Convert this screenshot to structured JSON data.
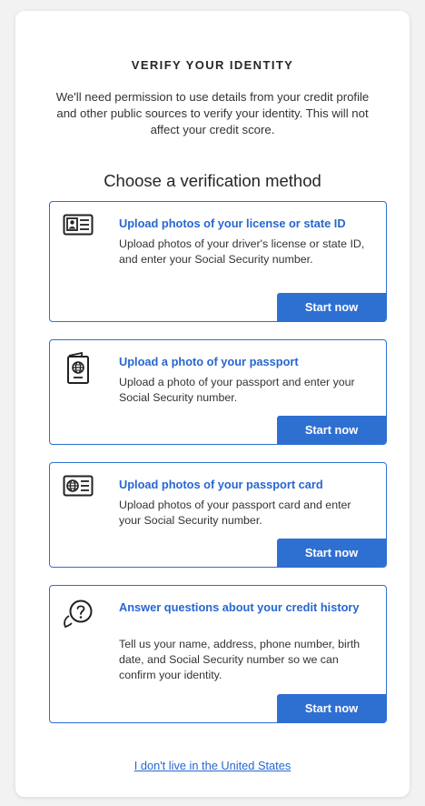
{
  "header": {
    "title": "VERIFY YOUR IDENTITY",
    "intro": "We'll need permission to use details from your credit profile and other public sources to verify your identity. This will not affect your credit score.",
    "choose_heading": "Choose a verification method"
  },
  "methods": [
    {
      "icon": "id-card-icon",
      "title": "Upload photos of your license or state ID",
      "description": "Upload photos of your driver's license or state ID, and enter your Social Security number.",
      "button": "Start now"
    },
    {
      "icon": "passport-icon",
      "title": "Upload a photo of your passport",
      "description": "Upload a photo of your passport and enter your Social Security number.",
      "button": "Start now"
    },
    {
      "icon": "passport-card-icon",
      "title": "Upload photos of your passport card",
      "description": "Upload photos of your passport card and enter your Social Security number.",
      "button": "Start now"
    },
    {
      "icon": "question-bubble-icon",
      "title": "Answer questions about your credit history",
      "description": "Tell us your name, address, phone number, birth date, and Social Security number so we can confirm your identity.",
      "button": "Start now"
    }
  ],
  "footer": {
    "link": "I don't live in the United States"
  },
  "colors": {
    "accent": "#2e6fd2",
    "link": "#2667d0",
    "page_background": "#f2f2f3"
  }
}
